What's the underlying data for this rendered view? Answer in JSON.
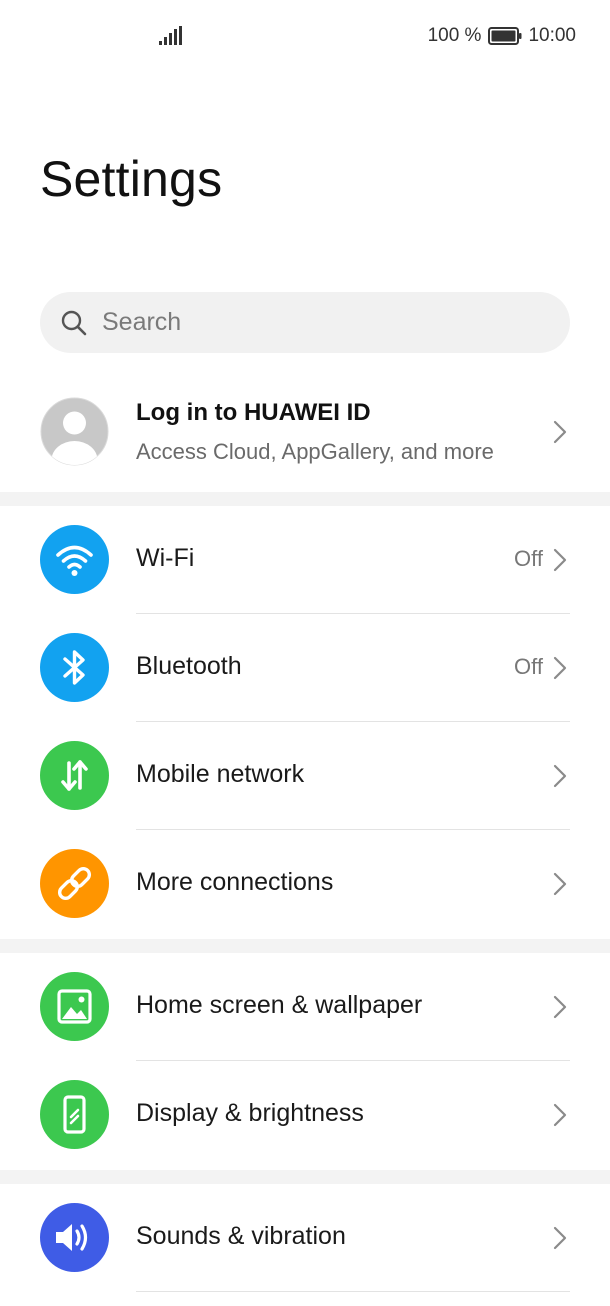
{
  "status_bar": {
    "battery_percent": "100 %",
    "time": "10:00"
  },
  "page_title": "Settings",
  "search": {
    "placeholder": "Search"
  },
  "account": {
    "title": "Log in to HUAWEI ID",
    "subtitle": "Access Cloud, AppGallery, and more"
  },
  "items": [
    {
      "label": "Wi-Fi",
      "value": "Off",
      "icon": "wifi-icon",
      "color": "#12a2f0"
    },
    {
      "label": "Bluetooth",
      "value": "Off",
      "icon": "bluetooth-icon",
      "color": "#12a2f0"
    },
    {
      "label": "Mobile network",
      "value": "",
      "icon": "mobile-data-icon",
      "color": "#3cc84f"
    },
    {
      "label": "More connections",
      "value": "",
      "icon": "link-icon",
      "color": "#ff9500"
    },
    {
      "label": "Home screen & wallpaper",
      "value": "",
      "icon": "image-icon",
      "color": "#3cc84f"
    },
    {
      "label": "Display & brightness",
      "value": "",
      "icon": "display-brightness-icon",
      "color": "#3cc84f"
    },
    {
      "label": "Sounds & vibration",
      "value": "",
      "icon": "speaker-icon",
      "color": "#3f5ce6"
    }
  ]
}
